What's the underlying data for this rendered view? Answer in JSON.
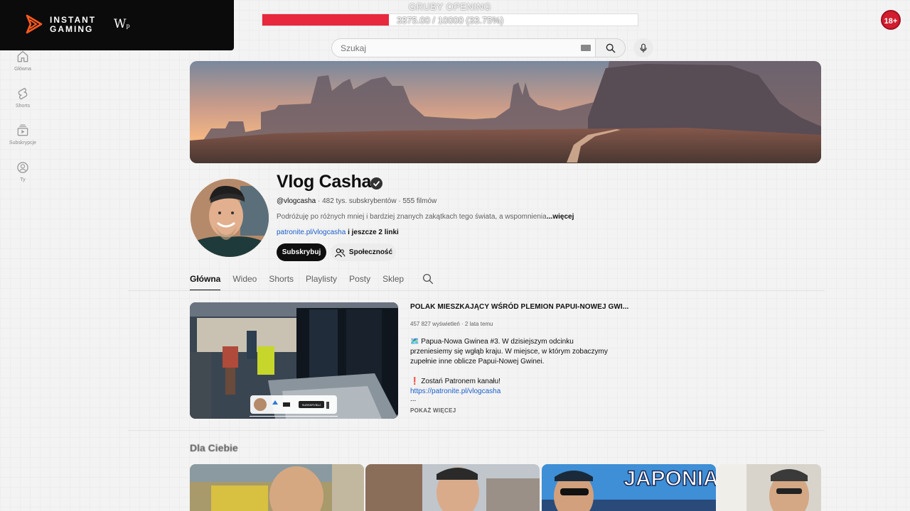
{
  "overlay": {
    "brand_line1": "INSTANT",
    "brand_line2": "GAMING",
    "partner_letter": "W",
    "partner_sub": "p",
    "goal_title": "GRUBY OPENING",
    "goal_text": "3375.00 / 10000 (33.75%)",
    "goal_progress": 0.3375,
    "age_badge": "18+"
  },
  "colors": {
    "goal_fill": "#e8283d",
    "link": "#1a5ec9",
    "subscribe_bg": "#0f0f0f"
  },
  "sidebar": {
    "items": [
      {
        "label": "Główna",
        "icon": "home-icon"
      },
      {
        "label": "Shorts",
        "icon": "shorts-icon"
      },
      {
        "label": "Subskrypcje",
        "icon": "subscriptions-icon"
      },
      {
        "label": "Ty",
        "icon": "you-icon"
      }
    ]
  },
  "search": {
    "placeholder": "Szukaj"
  },
  "channel": {
    "name": "Vlog Casha",
    "handle": "@vlogcasha",
    "stats": " · 482 tys. subskrybentów · 555 filmów",
    "description": "Podróżuję po różnych mniej i bardziej znanych zakątkach tego świata, a wspomnienia z",
    "more": "...więcej",
    "link": "patronite.pl/vlogcasha",
    "link_more": " i jeszcze 2 linki",
    "subscribe": "Subskrybuj",
    "community": "Społeczność"
  },
  "tabs": [
    "Główna",
    "Wideo",
    "Shorts",
    "Playlisty",
    "Posty",
    "Sklep"
  ],
  "featured": {
    "title": "POLAK MIESZKAJĄCY WŚRÓD PLEMION PAPUI-NOWEJ GWI...",
    "stats": "457 827 wyświetleń · 2 lata temu",
    "desc_line1": "🗺️ Papua-Nowa Gwinea #3. W dzisiejszym odcinku",
    "desc_line2": "przeniesiemy się wgłąb kraju. W miejsce, w którym zobaczymy",
    "desc_line3": "zupełnie inne oblicze Papui-Nowej Gwinei.",
    "desc_line4": "❗ Zostań Patronem kanału!",
    "desc_link": "https://patronite.pl/vlogcasha",
    "desc_ellipsis": "...",
    "show_more": "POKAŻ WIĘCEJ",
    "thumb_subscribe": "SUBSKRYBUJ"
  },
  "shelf": {
    "title": "Dla Ciebie",
    "thumb3_text": "JAPONIA"
  }
}
